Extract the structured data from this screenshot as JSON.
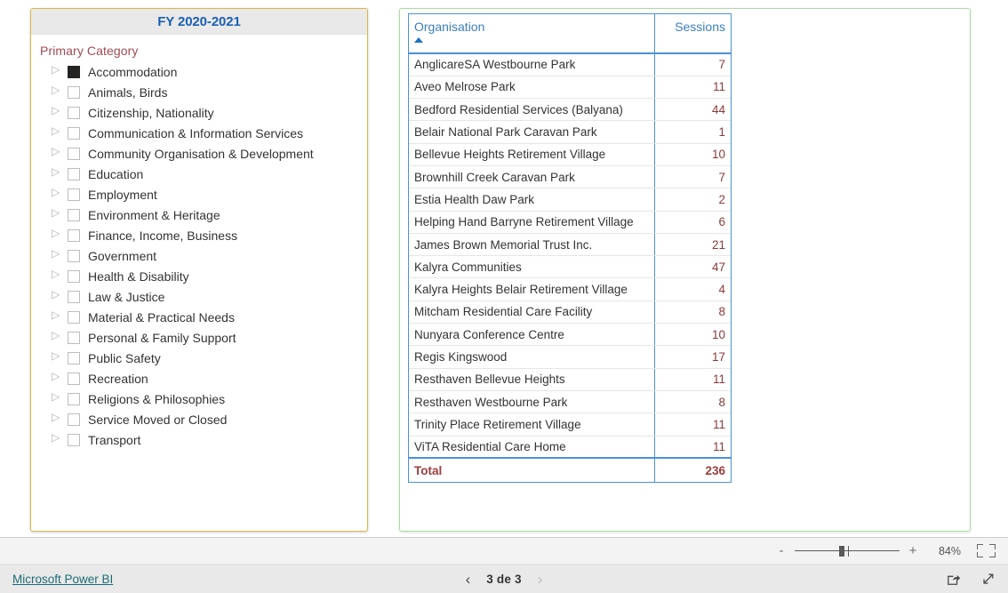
{
  "slicer": {
    "title": "FY 2020-2021",
    "field_label": "Primary Category",
    "items": [
      {
        "label": "Accommodation",
        "checked": true
      },
      {
        "label": "Animals, Birds",
        "checked": false
      },
      {
        "label": "Citizenship, Nationality",
        "checked": false
      },
      {
        "label": "Communication & Information Services",
        "checked": false
      },
      {
        "label": "Community Organisation & Development",
        "checked": false
      },
      {
        "label": "Education",
        "checked": false
      },
      {
        "label": "Employment",
        "checked": false
      },
      {
        "label": "Environment & Heritage",
        "checked": false
      },
      {
        "label": "Finance, Income, Business",
        "checked": false
      },
      {
        "label": "Government",
        "checked": false
      },
      {
        "label": "Health & Disability",
        "checked": false
      },
      {
        "label": "Law & Justice",
        "checked": false
      },
      {
        "label": "Material & Practical Needs",
        "checked": false
      },
      {
        "label": "Personal & Family Support",
        "checked": false
      },
      {
        "label": "Public Safety",
        "checked": false
      },
      {
        "label": "Recreation",
        "checked": false
      },
      {
        "label": "Religions & Philosophies",
        "checked": false
      },
      {
        "label": "Service Moved or Closed",
        "checked": false
      },
      {
        "label": "Transport",
        "checked": false
      }
    ]
  },
  "table": {
    "columns": [
      "Organisation",
      "Sessions"
    ],
    "sort_column": "Organisation",
    "sort_direction": "ascending",
    "sort_icon": "sort-ascending-icon",
    "rows": [
      {
        "organisation": "AnglicareSA Westbourne Park",
        "sessions": "7"
      },
      {
        "organisation": "Aveo Melrose Park",
        "sessions": "11"
      },
      {
        "organisation": "Bedford Residential Services (Balyana)",
        "sessions": "44"
      },
      {
        "organisation": "Belair National Park Caravan Park",
        "sessions": "1"
      },
      {
        "organisation": "Bellevue Heights Retirement Village",
        "sessions": "10"
      },
      {
        "organisation": "Brownhill Creek Caravan Park",
        "sessions": "7"
      },
      {
        "organisation": "Estia Health Daw Park",
        "sessions": "2"
      },
      {
        "organisation": "Helping Hand Barryne Retirement Village",
        "sessions": "6"
      },
      {
        "organisation": "James Brown Memorial Trust Inc.",
        "sessions": "21"
      },
      {
        "organisation": "Kalyra Communities",
        "sessions": "47"
      },
      {
        "organisation": "Kalyra Heights Belair Retirement Village",
        "sessions": "4"
      },
      {
        "organisation": "Mitcham Residential Care Facility",
        "sessions": "8"
      },
      {
        "organisation": "Nunyara Conference Centre",
        "sessions": "10"
      },
      {
        "organisation": "Regis Kingswood",
        "sessions": "17"
      },
      {
        "organisation": "Resthaven Bellevue Heights",
        "sessions": "11"
      },
      {
        "organisation": "Resthaven Westbourne Park",
        "sessions": "8"
      },
      {
        "organisation": "Trinity Place Retirement Village",
        "sessions": "11"
      },
      {
        "organisation": "ViTA Residential Care Home",
        "sessions": "11"
      }
    ],
    "total_label": "Total",
    "total_value": "236"
  },
  "toolbar": {
    "zoom_out_label": "-",
    "zoom_in_label": "+",
    "zoom_level": "84%",
    "fit_to_page_name": "fit-to-page-icon"
  },
  "footer": {
    "brand_label": "Microsoft Power BI",
    "prev_arrow": "‹",
    "next_arrow": "›",
    "page_indicator": "3 de 3",
    "share_icon": "share-icon",
    "fullscreen_icon": "fullscreen-icon"
  },
  "colors": {
    "accent_blue": "#1a5fb4",
    "table_border_blue": "#4a90d9",
    "measure_red": "#8a3b3b",
    "slicer_border_gold": "#d9b64a",
    "table_border_green": "#a8dda0",
    "field_label_red": "#a04a52",
    "link_teal": "#1b6b75"
  }
}
